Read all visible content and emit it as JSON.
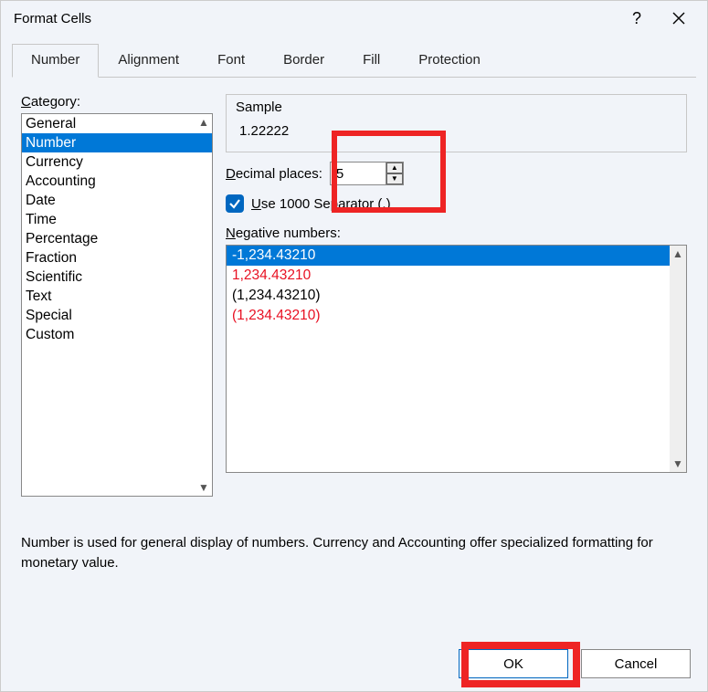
{
  "title": "Format Cells",
  "tabs": [
    "Number",
    "Alignment",
    "Font",
    "Border",
    "Fill",
    "Protection"
  ],
  "active_tab": 0,
  "category_label": "Category:",
  "categories": [
    "General",
    "Number",
    "Currency",
    "Accounting",
    "Date",
    "Time",
    "Percentage",
    "Fraction",
    "Scientific",
    "Text",
    "Special",
    "Custom"
  ],
  "selected_category": 1,
  "sample_label": "Sample",
  "sample_value": "1.22222",
  "decimal_label": "Decimal places:",
  "decimal_value": "5",
  "separator_label": "Use 1000 Separator (,)",
  "separator_checked": true,
  "negative_label": "Negative numbers:",
  "negatives": [
    {
      "text": "-1,234.43210",
      "selected": true,
      "red": false
    },
    {
      "text": "1,234.43210",
      "selected": false,
      "red": true
    },
    {
      "text": "(1,234.43210)",
      "selected": false,
      "red": false
    },
    {
      "text": "(1,234.43210)",
      "selected": false,
      "red": true
    }
  ],
  "description": "Number is used for general display of numbers.  Currency and Accounting offer specialized formatting for monetary value.",
  "ok_label": "OK",
  "cancel_label": "Cancel"
}
